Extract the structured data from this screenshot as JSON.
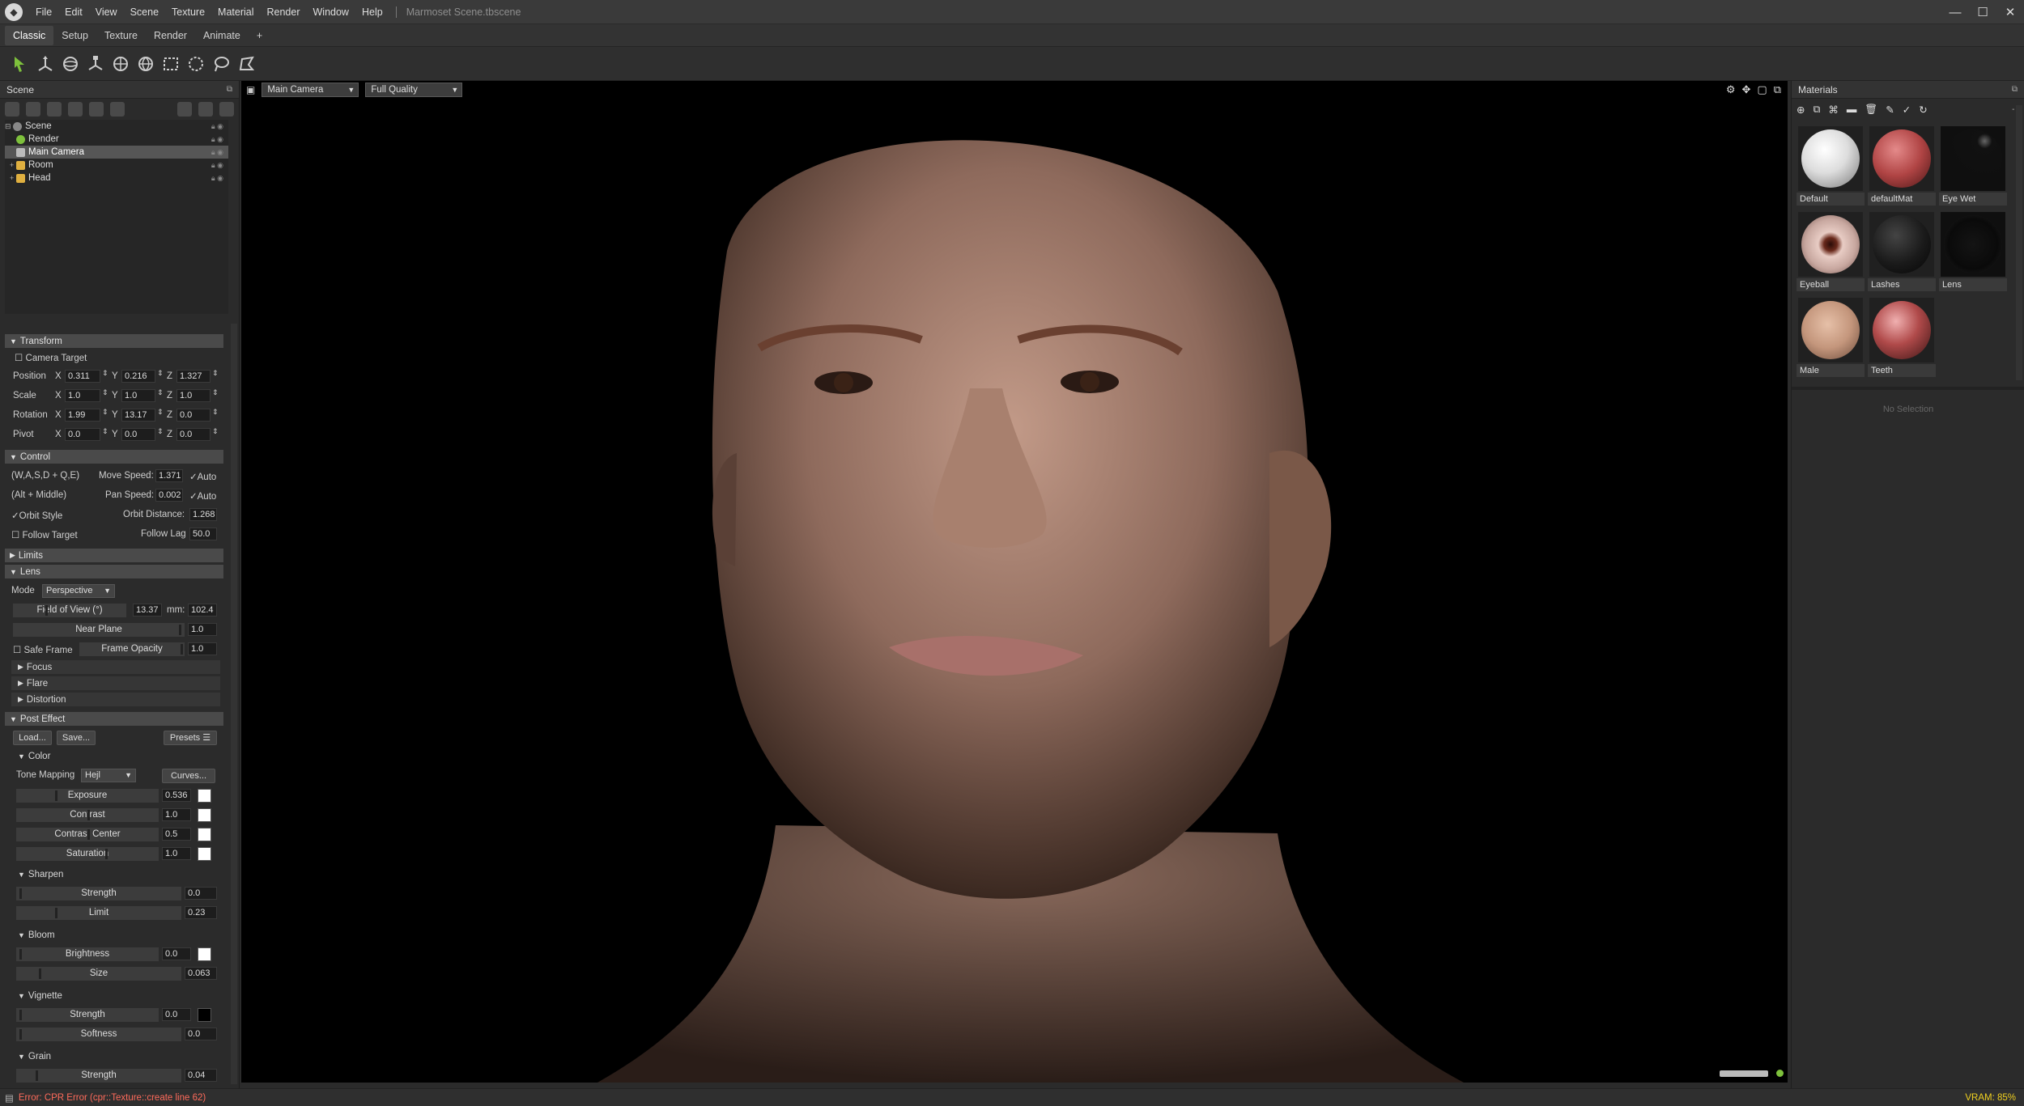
{
  "menu": [
    "File",
    "Edit",
    "View",
    "Scene",
    "Texture",
    "Material",
    "Render",
    "Window",
    "Help"
  ],
  "doc_title": "Marmoset Scene.tbscene",
  "workspace_tabs": [
    "Classic",
    "Setup",
    "Texture",
    "Render",
    "Animate",
    "+"
  ],
  "scene_panel": {
    "title": "Scene",
    "tree": [
      "Scene",
      "Render",
      "Main Camera",
      "Room",
      "Head"
    ]
  },
  "transform": {
    "title": "Transform",
    "camera_target": "Camera Target",
    "position": {
      "label": "Position",
      "x": "0.311",
      "y": "0.216",
      "z": "1.327"
    },
    "scale": {
      "label": "Scale",
      "x": "1.0",
      "y": "1.0",
      "z": "1.0"
    },
    "rotation": {
      "label": "Rotation",
      "x": "1.99",
      "y": "13.17",
      "z": "0.0"
    },
    "pivot": {
      "label": "Pivot",
      "x": "0.0",
      "y": "0.0",
      "z": "0.0"
    },
    "axis_x": "X",
    "axis_y": "Y",
    "axis_z": "Z"
  },
  "control": {
    "title": "Control",
    "keys1": "(W,A,S,D + Q,E)",
    "move_speed_label": "Move Speed:",
    "move_speed": "1.371",
    "auto1": "Auto",
    "keys2": "(Alt + Middle)",
    "pan_speed_label": "Pan Speed:",
    "pan_speed": "0.002",
    "auto2": "Auto",
    "orbit_style": "Orbit Style",
    "orbit_distance_label": "Orbit Distance:",
    "orbit_distance": "1.268",
    "follow_target": "Follow Target",
    "follow_lag_label": "Follow Lag",
    "follow_lag": "50.0"
  },
  "limits": "Limits",
  "lens": {
    "title": "Lens",
    "mode_label": "Mode",
    "mode": "Perspective",
    "fov_label": "Field of View (°)",
    "fov": "13.37",
    "mm_label": "mm:",
    "mm": "102.4",
    "near_plane_label": "Near Plane",
    "near_plane": "1.0",
    "safe_frame": "Safe Frame",
    "frame_opacity_label": "Frame Opacity",
    "frame_opacity": "1.0",
    "focus": "Focus",
    "flare": "Flare",
    "distortion": "Distortion"
  },
  "post_effect": {
    "title": "Post Effect",
    "load": "Load...",
    "save": "Save...",
    "presets": "Presets",
    "color": "Color",
    "tone_mapping_label": "Tone Mapping",
    "tone_mapping": "Hejl",
    "curves": "Curves...",
    "exposure_label": "Exposure",
    "exposure": "0.536",
    "contrast_label": "Contrast",
    "contrast": "1.0",
    "contrast_center_label": "Contrast Center",
    "contrast_center": "0.5",
    "saturation_label": "Saturation",
    "saturation": "1.0",
    "sharpen": "Sharpen",
    "sharpen_strength_label": "Strength",
    "sharpen_strength": "0.0",
    "sharpen_limit_label": "Limit",
    "sharpen_limit": "0.23",
    "bloom": "Bloom",
    "bloom_brightness_label": "Brightness",
    "bloom_brightness": "0.0",
    "bloom_size_label": "Size",
    "bloom_size": "0.063",
    "vignette": "Vignette",
    "vignette_strength_label": "Strength",
    "vignette_strength": "0.0",
    "vignette_softness_label": "Softness",
    "vignette_softness": "0.0",
    "grain": "Grain",
    "grain_strength_label": "Strength",
    "grain_strength": "0.04"
  },
  "viewport": {
    "camera": "Main Camera",
    "quality": "Full Quality"
  },
  "materials": {
    "title": "Materials",
    "zoom": "- /",
    "items": [
      "Default",
      "defaultMat",
      "Eye Wet",
      "Eyeball",
      "Lashes",
      "Lens",
      "Male",
      "Teeth"
    ],
    "no_selection": "No Selection"
  },
  "status": {
    "error": "Error: CPR Error (cpr::Texture::create line 62)",
    "vram": "VRAM: 85%"
  },
  "colors": {
    "accent": "#7ec13c",
    "error": "#ff6b5b",
    "vram": "#f0d020"
  }
}
